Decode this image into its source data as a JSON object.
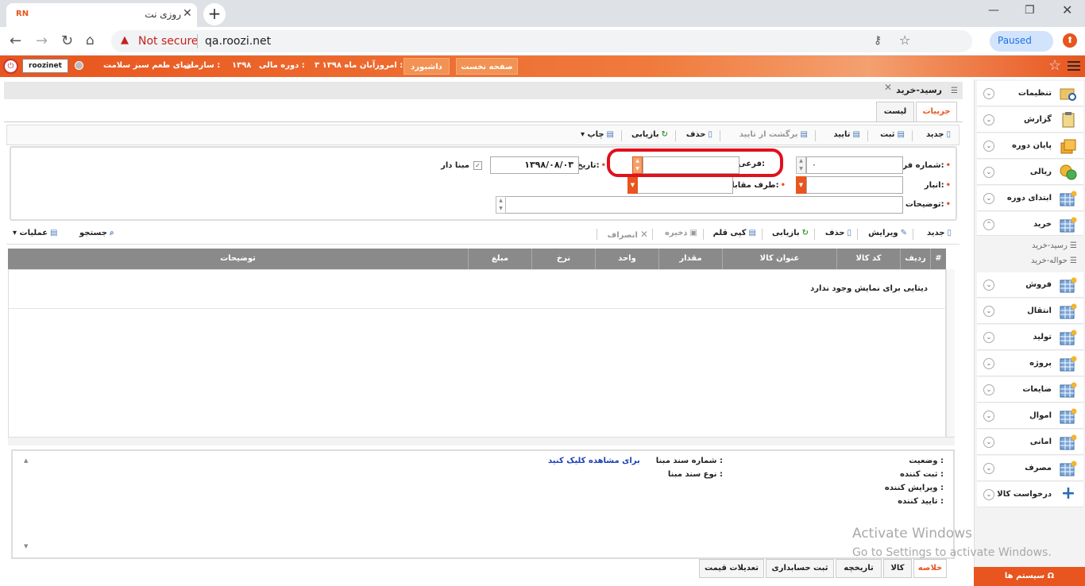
{
  "browser": {
    "tab_title": "روزی نت",
    "favicon": "RN",
    "url": "qa.roozi.net",
    "security": "Not secure",
    "profile": "Paused"
  },
  "topbar": {
    "username": "roozinet",
    "org_label": "سازمان :",
    "org": "دنیای طعم سبز سلامت",
    "fiscal_label": "دوره مالی :",
    "fiscal": "۱۳۹۸",
    "today_label": "امروز :",
    "today": "۳ آبان ماه ۱۳۹۸",
    "dashboard": "داشبورد",
    "home": "صفحه نخست"
  },
  "page": {
    "title": "رسید-خرید",
    "tab_details": "جزییات",
    "tab_list": "لیست"
  },
  "toolbar": {
    "new": "جدید",
    "save": "ثبت",
    "approve": "تایید",
    "unapprove": "برگشت از تایید",
    "delete": "حذف",
    "refresh": "بازیابی",
    "print": "چاپ"
  },
  "form": {
    "form_no_label": "شماره فرم:",
    "form_no_value": "۰",
    "sub_label": "فرعی:",
    "date_label": "تاریخ:",
    "date_value": "۱۳۹۸/۰۸/۰۳",
    "mabna_label": "مبنا دار",
    "warehouse_label": "انبار:",
    "party_label": "طرف مقابل:",
    "desc_label": "توضیحات:"
  },
  "itembar": {
    "new": "جدید",
    "edit": "ویرایش",
    "delete": "حذف",
    "refresh": "بازیابی",
    "copy": "کپی قلم",
    "save": "ذخیره",
    "cancel": "انصراف",
    "search": "جستجو",
    "ops": "عملیات"
  },
  "grid": {
    "columns": [
      "#",
      "ردیف",
      "کد کالا",
      "عنوان کالا",
      "مقدار",
      "واحد",
      "نرخ",
      "مبلغ",
      "توضیحات"
    ],
    "empty": "دیتایی برای نمایش وجود ندارد"
  },
  "summary": {
    "status": "وضعیت :",
    "creator": "ثبت کننده :",
    "editor": "ویرایش کننده :",
    "approver": "تایید کننده :",
    "base_no": "شماره سند مبنا :",
    "base_type": "نوع سند مبنا :",
    "link": "برای مشاهده کلیک کنید"
  },
  "bottom_tabs": [
    "خلاصه",
    "کالا",
    "تاریخچه",
    "ثبت حسابداری",
    "تعدیلات قیمت"
  ],
  "sidebar": {
    "items": [
      "تنظیمات",
      "گزارش",
      "پایان دوره",
      "ریالی",
      "ابتدای دوره",
      "خرید",
      "فروش",
      "انتقال",
      "تولید",
      "پروژه",
      "ضایعات",
      "اموال",
      "امانی",
      "مصرف",
      "درخواست کالا"
    ],
    "sub_items": [
      "رسید-خرید",
      "حواله-خرید"
    ],
    "system": "سیستم ها"
  },
  "watermark": {
    "line1": "Activate Windows",
    "line2": "Go to Settings to activate Windows."
  }
}
